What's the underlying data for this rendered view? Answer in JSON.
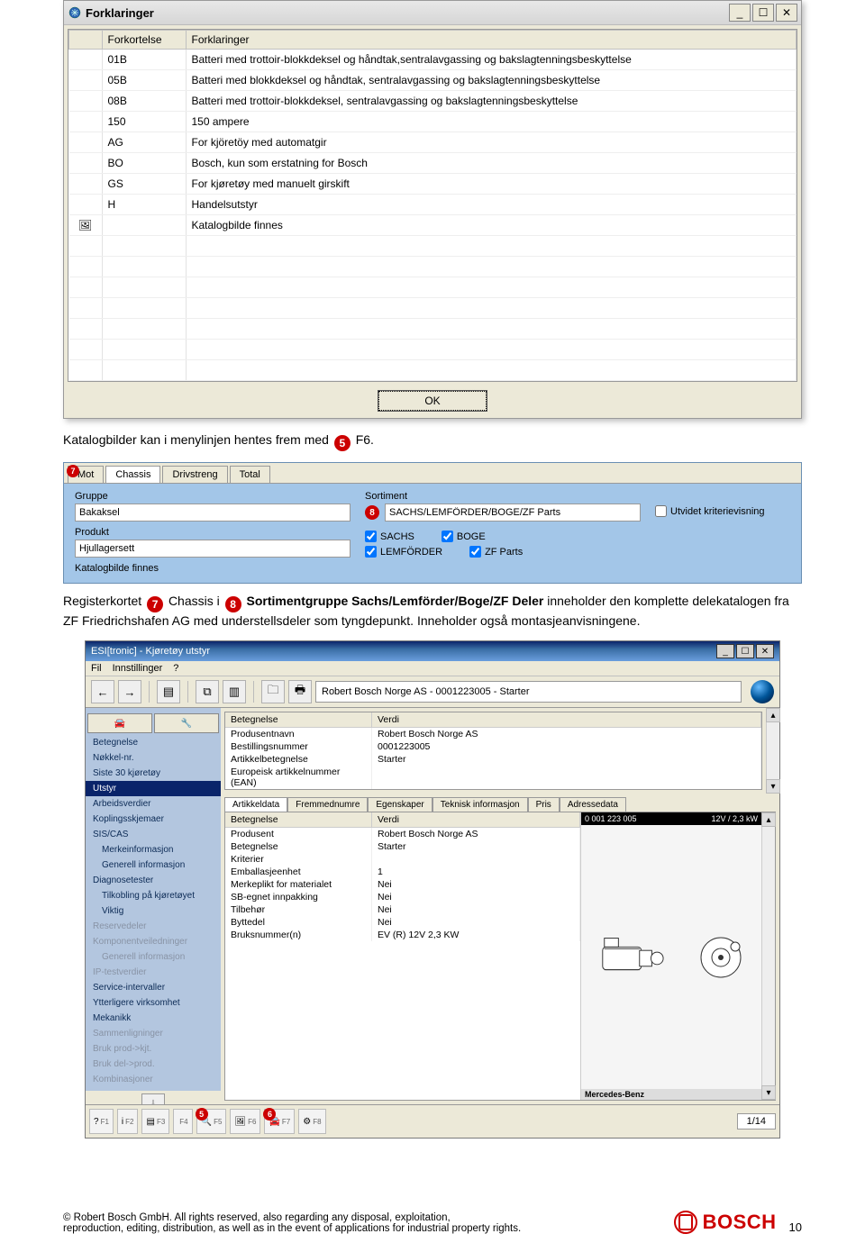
{
  "forklaringer_window": {
    "title": "Forklaringer",
    "columns": [
      "Forkortelse",
      "Forklaringer"
    ],
    "rows": [
      {
        "abbr": "01B",
        "desc": "Batteri med trottoir-blokkdeksel og håndtak,sentralavgassing og bakslagtenningsbeskyttelse"
      },
      {
        "abbr": "05B",
        "desc": "Batteri med blokkdeksel og håndtak, sentralavgassing og bakslagtenningsbeskyttelse"
      },
      {
        "abbr": "08B",
        "desc": "Batteri med trottoir-blokkdeksel, sentralavgassing og bakslagtenningsbeskyttelse"
      },
      {
        "abbr": "150",
        "desc": "150 ampere"
      },
      {
        "abbr": "AG",
        "desc": "For kjöretöy med automatgir"
      },
      {
        "abbr": "BO",
        "desc": "Bosch, kun som erstatning for Bosch"
      },
      {
        "abbr": "GS",
        "desc": "For kjøretøy med manuelt girskift"
      },
      {
        "abbr": "H",
        "desc": "Handelsutstyr"
      },
      {
        "abbr": "",
        "desc": "Katalogbilde finnes",
        "icon": true
      }
    ],
    "ok": "OK"
  },
  "para1": {
    "pre": "Katalogbilder kan i menylinjen hentes frem med ",
    "marker": "5",
    "post": " F6."
  },
  "chassis_panel": {
    "tabs": [
      "Mot",
      "Chassis",
      "Drivstreng",
      "Total"
    ],
    "tab_marker": "7",
    "labels": {
      "gruppe": "Gruppe",
      "produkt": "Produkt",
      "sortiment": "Sortiment",
      "utvidet": "Utvidet kriterievisning",
      "katalog": "Katalogbilde finnes"
    },
    "values": {
      "gruppe": "Bakaksel",
      "produkt": "Hjullagersett",
      "sortiment": "SACHS/LEMFÖRDER/BOGE/ZF Parts"
    },
    "sort_marker": "8",
    "checks": [
      {
        "label": "SACHS",
        "checked": true
      },
      {
        "label": "LEMFÖRDER",
        "checked": true
      },
      {
        "label": "BOGE",
        "checked": true
      },
      {
        "label": "ZF Parts",
        "checked": true
      }
    ]
  },
  "para2": {
    "pre": "Registerkortet ",
    "m1": "7",
    "mid1": " Chassis i ",
    "m2": "8",
    "mid2": " Sortimentgruppe Sachs/Lemförder/Boge/ZF Deler",
    "rest": " inneholder den komplette delekatalogen fra ZF Friedrichshafen AG med understellsdeler som tyngdepunkt. Inneholder også montasjeanvisningene."
  },
  "esi": {
    "title": "ESI[tronic] - Kjøretøy utstyr",
    "menus": [
      "Fil",
      "Innstillinger",
      "?"
    ],
    "selector": "Robert Bosch Norge AS - 0001223005 - Starter",
    "side": [
      {
        "t": "Betegnelse"
      },
      {
        "t": "Nøkkel-nr."
      },
      {
        "t": "Siste 30 kjøretøy"
      },
      {
        "t": "Utstyr",
        "active": true
      },
      {
        "t": "Arbeidsverdier"
      },
      {
        "t": "Koplingsskjemaer"
      },
      {
        "t": "SIS/CAS"
      },
      {
        "t": "Merkeinformasjon",
        "indent": true
      },
      {
        "t": "Generell informasjon",
        "indent": true
      },
      {
        "t": "Diagnosetester"
      },
      {
        "t": "Tilkobling på kjøretøyet",
        "indent": true
      },
      {
        "t": "Viktig",
        "indent": true
      },
      {
        "t": "Reservedeler",
        "dim": true
      },
      {
        "t": "Komponentveiledninger",
        "dim": true
      },
      {
        "t": "Generell informasjon",
        "indent": true,
        "dim": true
      },
      {
        "t": "IP-testverdier",
        "dim": true
      },
      {
        "t": "Service-intervaller"
      },
      {
        "t": "Ytterligere virksomhet"
      },
      {
        "t": "Mekanikk"
      },
      {
        "t": "Sammenligninger",
        "dim": true
      },
      {
        "t": "Bruk prod->kjt.",
        "dim": true
      },
      {
        "t": "Bruk del->prod.",
        "dim": true
      },
      {
        "t": "Kombinasjoner",
        "dim": true
      }
    ],
    "top_table": {
      "headers": [
        "Betegnelse",
        "Verdi"
      ],
      "rows": [
        [
          "Produsentnavn",
          "Robert Bosch Norge AS"
        ],
        [
          "Bestillingsnummer",
          "0001223005"
        ],
        [
          "Artikkelbetegnelse",
          "Starter"
        ],
        [
          "Europeisk artikkelnummer (EAN)",
          ""
        ]
      ]
    },
    "sub_tabs": [
      "Artikkeldata",
      "Fremmednumre",
      "Egenskaper",
      "Teknisk informasjon",
      "Pris",
      "Adressedata"
    ],
    "bottom_table": {
      "headers": [
        "Betegnelse",
        "Verdi"
      ],
      "rows": [
        [
          "Produsent",
          "Robert Bosch Norge AS"
        ],
        [
          "Betegnelse",
          "Starter"
        ],
        [
          "Kriterier",
          ""
        ],
        [
          "Emballasjeenhet",
          "1"
        ],
        [
          "Merkeplikt for materialet",
          "Nei"
        ],
        [
          "SB-egnet innpakking",
          "Nei"
        ],
        [
          "Tilbehør",
          "Nei"
        ],
        [
          "Byttedel",
          "Nei"
        ],
        [
          "Bruksnummer(n)",
          "EV (R) 12V 2,3 KW"
        ]
      ]
    },
    "part": {
      "number": "0 001 223 005",
      "spec": "12V / 2,3 kW",
      "brand": "Mercedes-Benz"
    },
    "fkeys": {
      "f5_marker": "5",
      "f6_marker": "6"
    },
    "page": "1/14"
  },
  "footer": {
    "line1": "© Robert Bosch GmbH. All rights reserved, also regarding any disposal, exploitation,",
    "line2": "reproduction, editing, distribution, as well as in the event of applications for industrial property rights.",
    "page": "10",
    "brand": "BOSCH"
  }
}
